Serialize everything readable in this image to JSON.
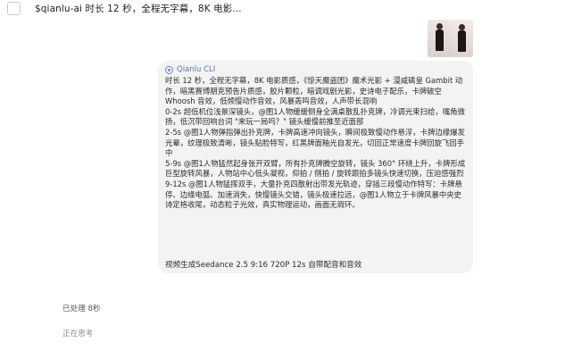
{
  "prompt": {
    "text": "$qianlu-ai 时长 12 秒，全程无字幕，8K 电影..."
  },
  "reply": {
    "agent_name": "Qianlu CLI",
    "paragraphs": [
      "时长 12 秒，全程无字幕，8K 电影质感，《惊天魔盗团》魔术光影 + 漫威磷皇 Gambit 动作，暗黑赛博朋克预告片质感，胶片颗粒，暗调戏剧光影，史诗电子配乐，卡牌破空 Whoosh 音效，低频慢动作音效，风暴轰鸣音效，人声带长混响",
      "0-2s 超低机位浅景深镜头，@图1人物缓缓侧身全满桌散乱扑克牌，冷调光束扫给，嘴角微扬，低沉带回响台词 \"来玩一局吗？\" 镜头缓慢前推至近面部",
      "2-5s @图1人物弹指弹出扑克牌，卡牌高速冲向镜头，瞬间极致慢动作悬浮，卡牌边缘爆发光晕，纹理极致清晰，镜头贴脸特写，红黑牌面釉光自发光，切回正常速度卡牌回旋飞回手中",
      "5-9s @图1人物猛然起身张开双臂，所有扑克牌腾空旋转，镜头 360° 环绕上升，卡牌形成巨型旋转风暴，人物站中心低头凝视，仰拍 / 侧拍 / 旋转跟拍多镜头快速切换，压迫感强烈",
      "9-12s @图1人物猛挥双手，大量扑克四散射出带发光轨迹，穿插三段慢动作特写：卡牌悬停、边缘电弧、加速消失，快慢镜头交错，镜头极速拉远，@图1人物立于卡牌风暴中央史诗定格收尾，动态粒子光效，真实物理运动，画面无瑕环。"
    ],
    "footer": "视频生成Seedance 2.5  9:16  720P  12s 自带配音和音效"
  },
  "status": {
    "done": "已处理 8秒",
    "thinking": "正在思考"
  }
}
